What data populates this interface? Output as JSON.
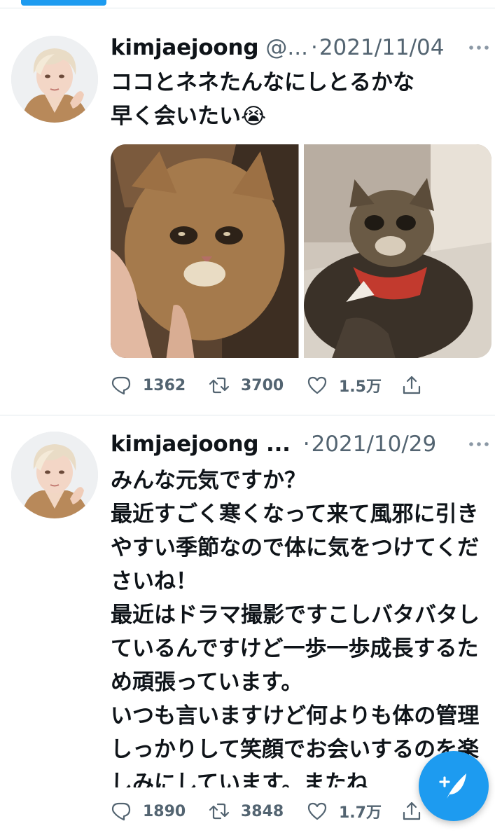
{
  "timeline": {
    "tweets": [
      {
        "name": "kimjaejoong",
        "handle": "@...",
        "separator": "·",
        "date": "2021/11/04",
        "text": "ココとネネたんなにしとるかな\n早く会いたい😭",
        "reply_count": "1362",
        "retweet_count": "3700",
        "like_count": "1.5万"
      },
      {
        "name": "kimjaejoong ...",
        "separator": "·",
        "date": "2021/10/29",
        "text": "みんな元気ですか？\n最近すごく寒くなって来て風邪に引きやすい季節なので体に気をつけてくださいね！\n最近はドラマ撮影ですこしバタバタしているんですけど一歩一歩成長するため頑張っています。\nいつも言いますけど何よりも体の管理しっかりして笑顔でお会いするのを楽しみにしています。またね",
        "reply_count": "1890",
        "retweet_count": "3848",
        "like_count": "1.7万"
      }
    ]
  },
  "icons": {
    "reply": "reply-icon",
    "retweet": "retweet-icon",
    "like": "heart-icon",
    "share": "share-icon",
    "more": "more-icon",
    "compose": "compose-tweet-icon"
  },
  "colors": {
    "accent": "#1d9bf0",
    "secondary_text": "#536471",
    "primary_text": "#0f1419",
    "divider": "#e1e8ed"
  }
}
